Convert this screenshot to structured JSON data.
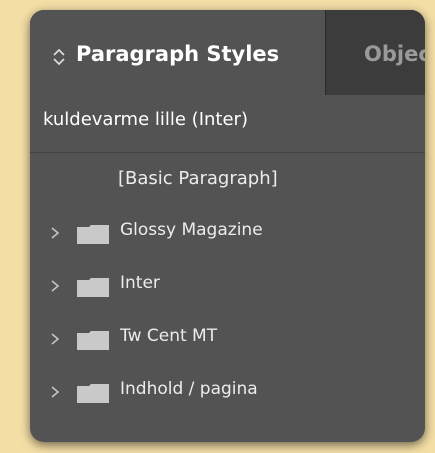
{
  "panel": {
    "active_tab": "Paragraph Styles",
    "next_tab": "Objec",
    "current_style": "kuldevarme lille (Inter)"
  },
  "styles": {
    "basic": "[Basic Paragraph]",
    "groups": [
      {
        "label": "Glossy Magazine",
        "icon": "folder-icon"
      },
      {
        "label": "Inter",
        "icon": "folder-icon"
      },
      {
        "label": "Tw Cent MT",
        "icon": "folder-icon"
      },
      {
        "label": "Indhold / pagina",
        "icon": "folder-icon"
      }
    ]
  },
  "colors": {
    "page_background": "#f3dea6",
    "panel_background": "#535353",
    "tab_bar": "#3c3c3c",
    "text": "#ffffff",
    "folder": "#c9c9c9"
  }
}
